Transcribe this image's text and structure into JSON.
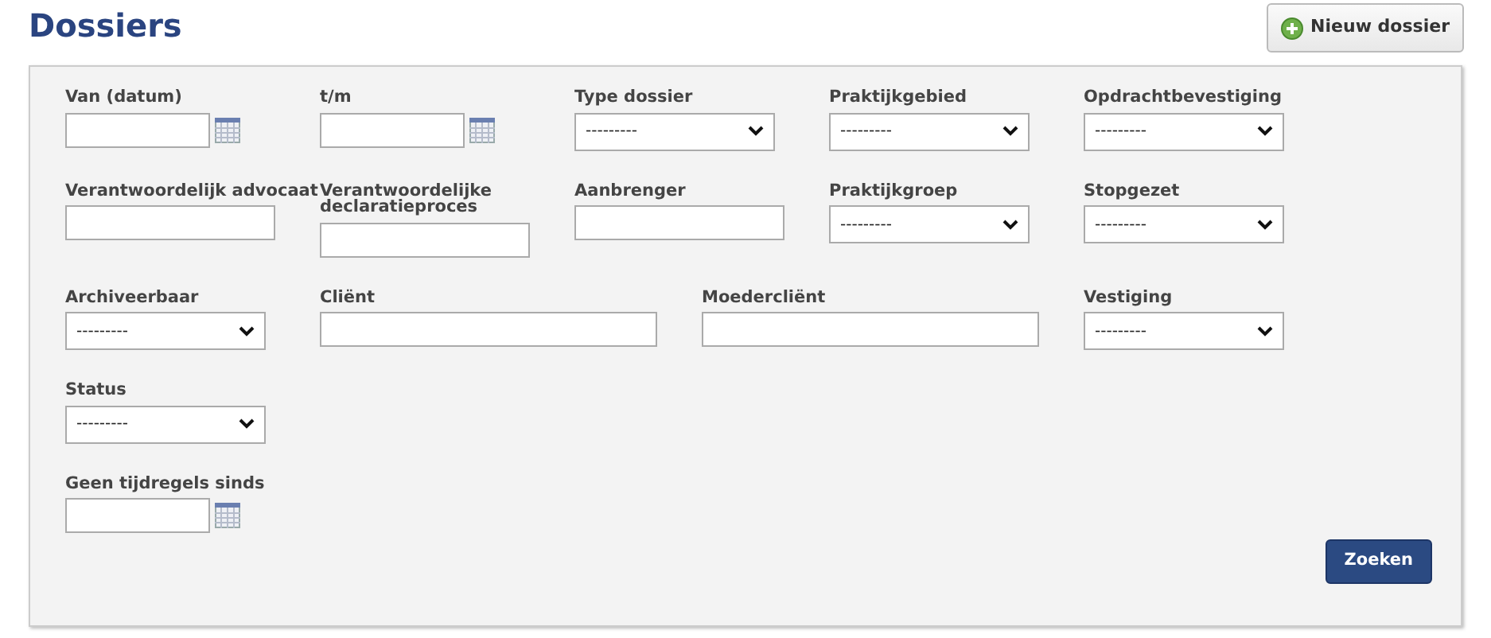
{
  "title": "Dossiers",
  "new_button": {
    "label": "Nieuw dossier"
  },
  "rows": [
    [
      {
        "kind": "date",
        "label": "Van (datum)"
      },
      {
        "kind": "date",
        "label": "t/m"
      },
      {
        "kind": "select",
        "label": "Type dossier",
        "value": "---------"
      },
      {
        "kind": "select",
        "label": "Praktijkgebied",
        "value": "---------"
      },
      {
        "kind": "select",
        "label": "Opdrachtbevestiging",
        "value": "---------"
      }
    ],
    [
      {
        "kind": "text",
        "label": "Verantwoordelijk advocaat"
      },
      {
        "kind": "text",
        "label": "Verantwoordelijke declaratieproces"
      },
      {
        "kind": "text",
        "label": "Aanbrenger"
      },
      {
        "kind": "select",
        "label": "Praktijkgroep",
        "value": "---------"
      },
      {
        "kind": "select",
        "label": "Stopgezet",
        "value": "---------"
      }
    ],
    [
      {
        "kind": "select",
        "label": "Archiveerbaar",
        "value": "---------"
      },
      {
        "kind": "wide",
        "label": "Cliënt"
      },
      {
        "kind": "wide",
        "label": "Moedercliënt"
      },
      {
        "kind": "select",
        "label": "Vestiging",
        "value": "---------"
      }
    ],
    [
      {
        "kind": "select",
        "label": "Status",
        "value": "---------"
      }
    ],
    [
      {
        "kind": "date",
        "label": "Geen tijdregels sinds"
      }
    ]
  ],
  "search_button": {
    "label": "Zoeken"
  }
}
